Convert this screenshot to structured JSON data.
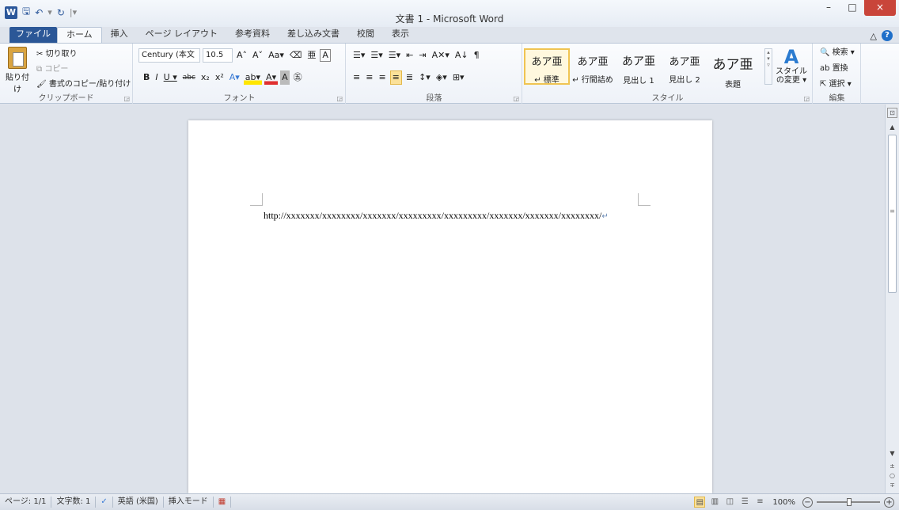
{
  "window": {
    "title": "文書 1 - Microsoft Word",
    "logo": "W",
    "minimize": "–",
    "maximize": "□",
    "close": "×"
  },
  "qat": {
    "save": "🖫",
    "undo": "↶",
    "undo_drop": "▾",
    "redo": "↻",
    "customize": "|▾"
  },
  "tabs": [
    "ファイル",
    "ホーム",
    "挿入",
    "ページ レイアウト",
    "参考資料",
    "差し込み文書",
    "校閲",
    "表示"
  ],
  "tab_right": {
    "minimize_ribbon": "△",
    "help": "?"
  },
  "clipboard": {
    "paste": "貼り付け",
    "cut": "✂ 切り取り",
    "copy": "⧉ コピー",
    "format_painter": "🖌 書式のコピー/貼り付け",
    "label": "クリップボード"
  },
  "font": {
    "name": "Century (本文",
    "size": "10.5",
    "grow": "A˄",
    "shrink": "A˅",
    "case": "Aa▾",
    "clear": "⌫",
    "phonetic": "亜",
    "border": "A",
    "bold": "B",
    "italic": "I",
    "underline": "U ▾",
    "strike": "abc",
    "sub": "x₂",
    "sup": "x²",
    "effects": "A▾",
    "highlight": "ab▾",
    "color": "A▾",
    "shading": "A",
    "enclose": "㊄",
    "label": "フォント"
  },
  "paragraph": {
    "bullets": "☰▾",
    "numbering": "☰▾",
    "multilevel": "☰▾",
    "dec_indent": "⇤",
    "inc_indent": "⇥",
    "asian_layout": "A✕▾",
    "sort": "A↓",
    "show_marks": "¶",
    "left": "≡",
    "center": "≡",
    "right": "≡",
    "justify": "≡",
    "distributed": "≣",
    "line_spacing": "↕▾",
    "shading": "◈▾",
    "borders": "⊞▾",
    "label": "段落"
  },
  "styles": {
    "items": [
      {
        "sample": "あア亜",
        "name": "↵ 標準"
      },
      {
        "sample": "あア亜",
        "name": "↵ 行間詰め"
      },
      {
        "sample": "あア亜",
        "name": "見出し 1"
      },
      {
        "sample": "あア亜",
        "name": "見出し 2"
      },
      {
        "sample": "あア亜",
        "name": "表題"
      }
    ],
    "change_icon": "A",
    "change_label": "スタイルの変更 ▾",
    "label": "スタイル"
  },
  "editing": {
    "find": "🔍 検索 ▾",
    "replace": "ab 置換",
    "select": "⇱ 選択 ▾",
    "label": "編集"
  },
  "document": {
    "text": "http://xxxxxxx/xxxxxxxx/xxxxxxx/xxxxxxxxx/xxxxxxxxx/xxxxxxx/xxxxxxx/xxxxxxxx/",
    "para_mark": "↵"
  },
  "scrollbar": {
    "ruler": "⊡",
    "up": "▲",
    "down": "▼",
    "grip": "≡",
    "prev": "±",
    "browse": "○",
    "next": "∓"
  },
  "status": {
    "page": "ページ: 1/1",
    "words": "文字数: 1",
    "proof_icon": "✓",
    "language": "英語 (米国)",
    "mode": "挿入モード",
    "macro_icon": "▦",
    "zoom": "100%",
    "zoom_out": "−",
    "zoom_in": "+",
    "view_print": "▤",
    "view_read": "▥",
    "view_web": "◫",
    "view_outline": "☰",
    "view_draft": "≡"
  }
}
